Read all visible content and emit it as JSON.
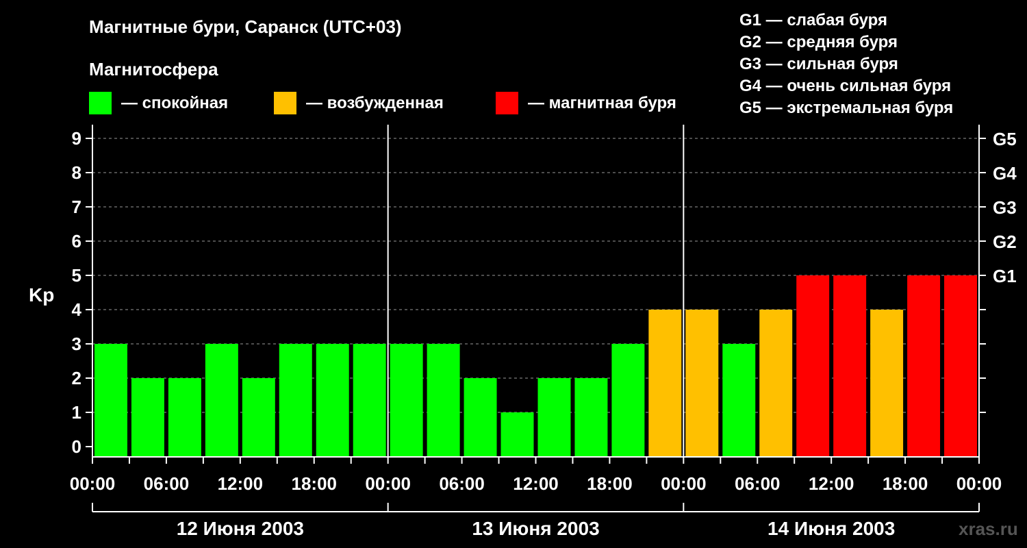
{
  "chart_data": {
    "type": "bar",
    "title": "Магнитные бури, Саранск (UTC+03)",
    "subtitle": "Магнитосфера",
    "ylabel": "Kp",
    "ylim": [
      0,
      9
    ],
    "grid": true,
    "legend": [
      {
        "label": "— спокойная",
        "color": "#00ff00"
      },
      {
        "label": "— возбужденная",
        "color": "#ffc000"
      },
      {
        "label": "— магнитная буря",
        "color": "#ff0000"
      }
    ],
    "storm_legend": [
      "G1 — слабая буря",
      "G2 — средняя буря",
      "G3 — сильная буря",
      "G4 — очень сильная буря",
      "G5 — экстремальная буря"
    ],
    "y_ticks": [
      "0",
      "1",
      "2",
      "3",
      "4",
      "5",
      "6",
      "7",
      "8",
      "9"
    ],
    "right_ticks": [
      {
        "kp": 5,
        "label": "G1"
      },
      {
        "kp": 6,
        "label": "G2"
      },
      {
        "kp": 7,
        "label": "G3"
      },
      {
        "kp": 8,
        "label": "G4"
      },
      {
        "kp": 9,
        "label": "G5"
      }
    ],
    "x_tick_labels": [
      "00:00",
      "06:00",
      "12:00",
      "18:00",
      "00:00",
      "06:00",
      "12:00",
      "18:00",
      "00:00",
      "06:00",
      "12:00",
      "18:00",
      "00:00"
    ],
    "days": [
      "12 Июня 2003",
      "13 Июня 2003",
      "14 Июня 2003"
    ],
    "values": [
      3,
      2,
      2,
      3,
      2,
      3,
      3,
      3,
      3,
      3,
      2,
      1,
      2,
      2,
      3,
      4,
      4,
      3,
      4,
      5,
      5,
      4,
      5,
      5
    ],
    "colors": {
      "calm": "#00ff00",
      "excited": "#ffc000",
      "storm": "#ff0000"
    }
  },
  "watermark": "xras.ru"
}
